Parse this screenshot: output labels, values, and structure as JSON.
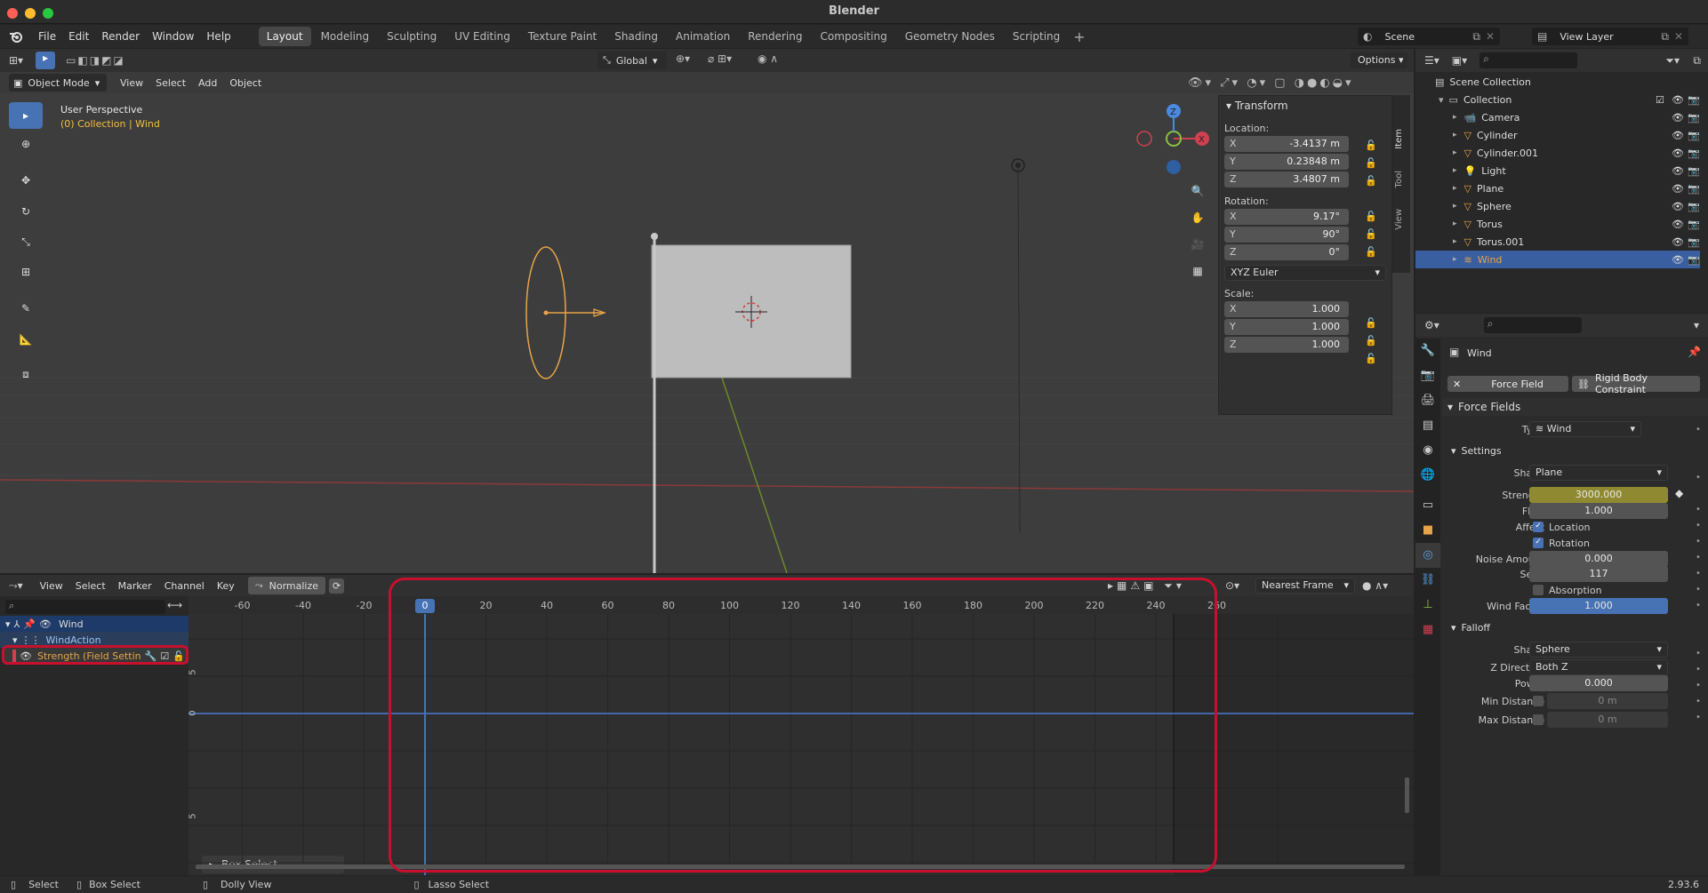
{
  "window": {
    "title": "Blender",
    "version": "2.93.6"
  },
  "menus": [
    "File",
    "Edit",
    "Render",
    "Window",
    "Help"
  ],
  "workspaces": [
    "Layout",
    "Modeling",
    "Sculpting",
    "UV Editing",
    "Texture Paint",
    "Shading",
    "Animation",
    "Rendering",
    "Compositing",
    "Geometry Nodes",
    "Scripting"
  ],
  "scene": {
    "scene_name": "Scene",
    "view_layer": "View Layer"
  },
  "viewport": {
    "mode": "Object Mode",
    "menu": [
      "View",
      "Select",
      "Add",
      "Object"
    ],
    "orientation": "Global",
    "options": "Options",
    "perspective": "User Perspective",
    "collection_info": "(0) Collection | Wind",
    "tabs": [
      "Item",
      "Tool",
      "View"
    ]
  },
  "transform": {
    "title": "Transform",
    "location_label": "Location:",
    "rotation_label": "Rotation:",
    "scale_label": "Scale:",
    "axes": [
      "X",
      "Y",
      "Z"
    ],
    "location": [
      "-3.4137 m",
      "0.23848 m",
      "3.4807 m"
    ],
    "rotation": [
      "9.17°",
      "90°",
      "0°"
    ],
    "rotation_mode": "XYZ Euler",
    "scale": [
      "1.000",
      "1.000",
      "1.000"
    ]
  },
  "outliner": {
    "scene_collection": "Scene Collection",
    "collection": "Collection",
    "items": [
      "Camera",
      "Cylinder",
      "Cylinder.001",
      "Light",
      "Plane",
      "Sphere",
      "Torus",
      "Torus.001",
      "Wind"
    ],
    "selected": "Wind"
  },
  "properties": {
    "object_name": "Wind",
    "force_field_btn": "Force Field",
    "rigid_body_btn": "Rigid Body Constraint",
    "section_force_fields": "Force Fields",
    "type_label": "Type",
    "type_value": "Wind",
    "section_settings": "Settings",
    "shape_label": "Shape",
    "shape_value": "Plane",
    "strength_label": "Strength",
    "strength_value": "3000.000",
    "flow_label": "Flow",
    "flow_value": "1.000",
    "affect_label": "Affect",
    "location_cb": "Location",
    "rotation_cb": "Rotation",
    "noise_label": "Noise Amount",
    "noise_value": "0.000",
    "seed_label": "Seed",
    "seed_value": "117",
    "absorption_cb": "Absorption",
    "wind_factor_label": "Wind Factor",
    "wind_factor_value": "1.000",
    "section_falloff": "Falloff",
    "falloff_shape_label": "Shape",
    "falloff_shape_value": "Sphere",
    "zdir_label": "Z Direction",
    "zdir_value": "Both Z",
    "power_label": "Power",
    "power_value": "0.000",
    "min_dist_label": "Min Distance",
    "min_dist_value": "0 m",
    "max_dist_label": "Max Distance",
    "max_dist_value": "0 m"
  },
  "graph_editor": {
    "menu": [
      "View",
      "Select",
      "Marker",
      "Channel",
      "Key"
    ],
    "normalize": "Normalize",
    "snap": "Nearest Frame",
    "current_frame": "0",
    "frame_ticks": [
      "-60",
      "-40",
      "-20",
      "20",
      "40",
      "60",
      "80",
      "100",
      "120",
      "140",
      "160",
      "180",
      "200",
      "220",
      "240",
      "260"
    ],
    "channels": [
      "Wind",
      "WindAction",
      "Strength (Field Settin"
    ],
    "y_ticks": [
      "5",
      "0",
      "5"
    ],
    "operator_panel": "Box Select"
  },
  "statusbar": {
    "items": [
      "Select",
      "Box Select",
      "Dolly View",
      "Lasso Select"
    ]
  },
  "colors": {
    "accent": "#4772b3",
    "highlight_box": "#c8102e",
    "strength_field": "#8f8a32",
    "selection": "#3a5fa0",
    "object_orange": "#e8a448"
  }
}
